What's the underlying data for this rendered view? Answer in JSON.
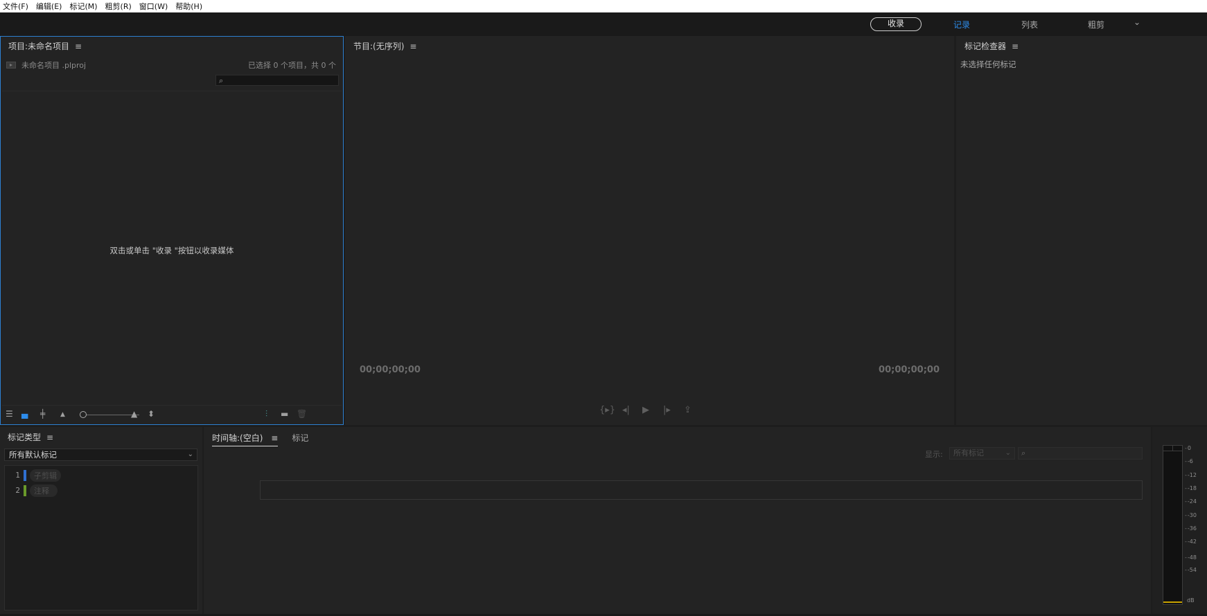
{
  "menubar": {
    "items": [
      "文件(F)",
      "编辑(E)",
      "标记(M)",
      "粗剪(R)",
      "窗口(W)",
      "帮助(H)"
    ]
  },
  "workspaces": {
    "ingest": "收录",
    "tabs": [
      "记录",
      "列表",
      "粗剪"
    ],
    "active_tab": "记录"
  },
  "project_panel": {
    "title": "项目:未命名项目",
    "file": "未命名项目 .plproj",
    "count": "已选择 0 个项目，共 0 个",
    "search_placeholder": "",
    "empty_hint": "双击或单击 \"收录 \"按钮以收录媒体"
  },
  "program_panel": {
    "title": "节目:(无序列)",
    "timecode_in": "00;00;00;00",
    "timecode_out": "00;00;00;00"
  },
  "inspector_panel": {
    "title": "标记检查器",
    "empty": "未选择任何标记"
  },
  "marker_types_panel": {
    "title": "标记类型",
    "selected": "所有默认标记",
    "items": [
      {
        "num": "1",
        "name": "子剪辑",
        "color": "#2f6fcf"
      },
      {
        "num": "2",
        "name": "注释",
        "color": "#6a9a2a"
      }
    ]
  },
  "timeline_panel": {
    "tab_timeline": "时间轴:(空白)",
    "tab_markers": "标记",
    "show_label": "显示:",
    "filter_value": "所有标记",
    "search_placeholder": ""
  },
  "audio_meter": {
    "ticks": [
      "0",
      "-6",
      "-12",
      "-18",
      "-24",
      "-30",
      "-36",
      "-42",
      "-48",
      "-54"
    ],
    "unit": "dB"
  },
  "colors": {
    "accent": "#2d8ceb",
    "panel_bg": "#232323",
    "app_bg": "#1d1d1d",
    "focus_border": "#2d80d2"
  }
}
